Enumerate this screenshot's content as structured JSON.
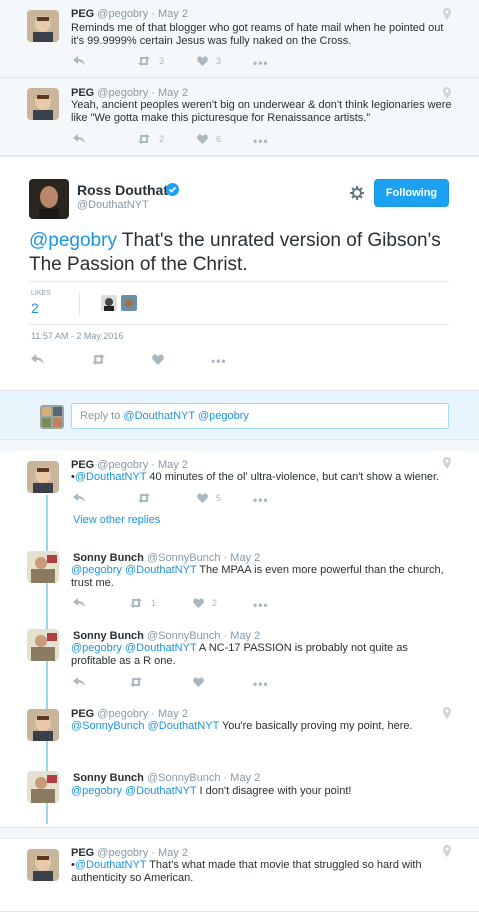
{
  "top_replies": [
    {
      "name": "PEG",
      "handle": "@pegobry",
      "time": "May 2",
      "text": "Reminds me of that blogger who got reams of hate mail when he pointed out it's 99.9999% certain Jesus was fully naked on the Cross.",
      "retweets": "3",
      "likes": "3"
    },
    {
      "name": "PEG",
      "handle": "@pegobry",
      "time": "May 2",
      "text": "Yeah, ancient peoples weren't big on underwear & don't think legionaries were like \"We gotta make this picturesque for Renaissance artists.\"",
      "retweets": "2",
      "likes": "6"
    }
  ],
  "main_tweet": {
    "name": "Ross Douthat",
    "handle": "@DouthatNYT",
    "follow_label": "Following",
    "mention": "@pegobry",
    "text": " That's the unrated version of Gibson's The Passion of the Christ.",
    "likes_label": "LIKES",
    "likes_count": "2",
    "timestamp": "11:57 AM - 2 May 2016"
  },
  "reply_box": {
    "prefix": "Reply to ",
    "mentions": "@DouthatNYT @pegobry"
  },
  "conversation": [
    {
      "name": "PEG",
      "handle": "@pegobry",
      "time": "May 2",
      "mention": "@DouthatNYT",
      "bullet": "•",
      "text": " 40 minutes of the ol' ultra-violence, but can't show a wiener.",
      "retweets": "",
      "likes": "5"
    },
    {
      "name": "Sonny Bunch",
      "handle": "@SonnyBunch",
      "time": "May 2",
      "mention": "@pegobry @DouthatNYT",
      "text": " The MPAA is even more powerful than the church, trust me.",
      "retweets": "1",
      "likes": "2"
    },
    {
      "name": "Sonny Bunch",
      "handle": "@SonnyBunch",
      "time": "May 2",
      "mention": "@pegobry @DouthatNYT",
      "text": " A NC-17 PASSION is probably not quite as profitable as a R one.",
      "retweets": "",
      "likes": ""
    },
    {
      "name": "PEG",
      "handle": "@pegobry",
      "time": "May 2",
      "mention": "@SonnyBunch @DouthatNYT",
      "text": " You're basically proving my point, here.",
      "retweets": "",
      "likes": ""
    },
    {
      "name": "Sonny Bunch",
      "handle": "@SonnyBunch",
      "time": "May 2",
      "mention": "@pegobry @DouthatNYT",
      "text": " I don't disagree with your point!",
      "retweets": "",
      "likes": ""
    },
    {
      "name": "PEG",
      "handle": "@pegobry",
      "time": "May 2",
      "mention": "@DouthatNYT",
      "bullet": "•",
      "text": " That's what made that movie that struggled so hard with authenticity so American.",
      "retweets": "",
      "likes": ""
    }
  ],
  "view_other_replies": "View other replies",
  "separator": " · ",
  "colors": {
    "accent": "#1da1f2",
    "link": "#1b95e0",
    "icon": "#aab8c2",
    "thread": "#9ed6f0"
  }
}
